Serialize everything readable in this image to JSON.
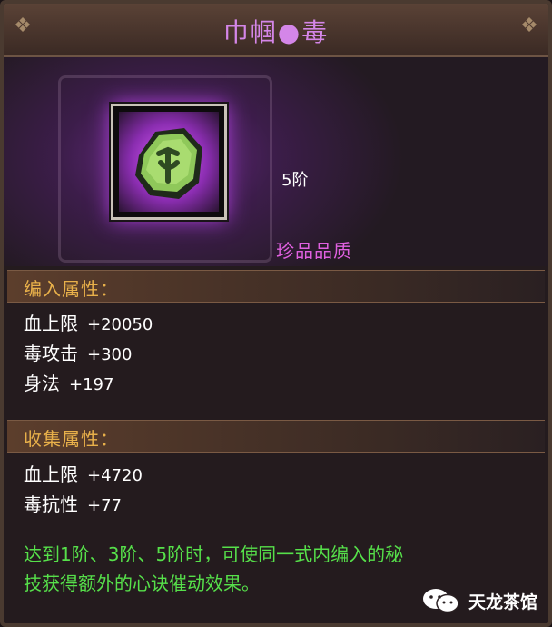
{
  "window": {
    "title": "巾帼●毒"
  },
  "item": {
    "rank": "5阶",
    "quality": "珍品品质",
    "icon": "green-rune-stone-icon",
    "glow_color": "#b040e0"
  },
  "embed_section": {
    "title": "编入属性：",
    "attributes": [
      {
        "name": "血上限",
        "value": "+20050"
      },
      {
        "name": "毒攻击",
        "value": "+300"
      },
      {
        "name": "身法",
        "value": "+197"
      }
    ]
  },
  "collect_section": {
    "title": "收集属性：",
    "attributes": [
      {
        "name": "血上限",
        "value": "+4720"
      },
      {
        "name": "毒抗性",
        "value": "+77"
      }
    ]
  },
  "description": {
    "line1": "达到1阶、3阶、5阶时，可使同一式内编入的秘",
    "line2": "技获得额外的心诀催动效果。"
  },
  "watermark": {
    "text": "天龙茶馆",
    "icon": "wechat-icon"
  },
  "colors": {
    "title": "#d486e8",
    "quality": "#e060e0",
    "section_title": "#e8b04a",
    "description": "#56e04a"
  }
}
